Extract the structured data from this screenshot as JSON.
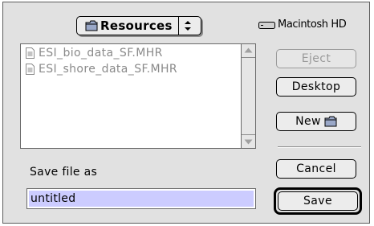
{
  "folder_popup": {
    "label": "Resources",
    "icon": "folder-icon"
  },
  "disk": {
    "label": "Macintosh HD",
    "icon": "hard-disk-icon"
  },
  "files": [
    {
      "name": "ESI_bio_data_SF.MHR",
      "icon": "document-icon"
    },
    {
      "name": "ESI_shore_data_SF.MHR",
      "icon": "document-icon"
    }
  ],
  "buttons": {
    "eject": "Eject",
    "desktop": "Desktop",
    "new": "New",
    "cancel": "Cancel",
    "save": "Save"
  },
  "save_as": {
    "label": "Save file as",
    "value": "untitled"
  },
  "colors": {
    "dialog_bg": "#e1e1e1",
    "selection": "#ccccff",
    "disabled_text": "#9a9a9a"
  }
}
